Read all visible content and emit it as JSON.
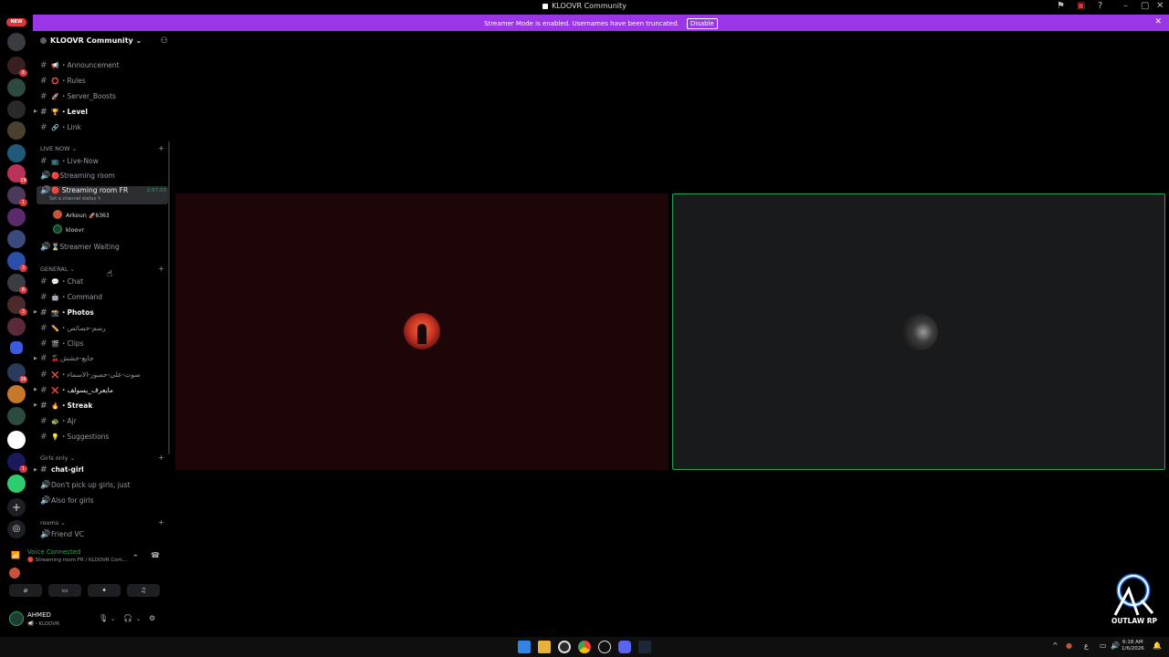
{
  "window": {
    "title": "KLOOVR Community"
  },
  "banner": {
    "message": "Streamer Mode is enabled. Usernames have been truncated.",
    "disable_label": "Disable"
  },
  "rail": {
    "new_badge": "NEW",
    "badges": [
      "6",
      "29",
      "1",
      "3",
      "8",
      "3",
      "1",
      "36"
    ]
  },
  "server": {
    "name": "KLOOVR Community ⌄"
  },
  "channels_top": [
    {
      "emoji": "📢",
      "label": "・Announcement",
      "bold": false
    },
    {
      "emoji": "⭕",
      "label": "・Rules",
      "bold": false
    },
    {
      "emoji": "🚀",
      "label": "・Server_Boosts",
      "bold": false
    },
    {
      "emoji": "🏆",
      "label": "・Level",
      "bold": true
    },
    {
      "emoji": "🔗",
      "label": "・Link",
      "bold": false
    }
  ],
  "live_now": {
    "category": "LIVE NOW ⌄",
    "text_channel": {
      "emoji": "📺",
      "label": "・Live-Now"
    },
    "voice_1": {
      "label": "🔴Streaming room"
    },
    "active": {
      "label": "🔴 Streaming room FR",
      "timer": "2:57:03",
      "status": "Set a channel status ✎"
    },
    "users": [
      {
        "name": "Arkoun",
        "tag": "🚀6363",
        "color": "#c8523a"
      },
      {
        "name": "kloovr",
        "tag": "",
        "color": "#1f3d30"
      }
    ],
    "voice_2": {
      "label": "⌛Streamer Waiting"
    }
  },
  "general": {
    "category": "GENERAL ⌄",
    "channels": [
      {
        "emoji": "💬",
        "label": "・Chat",
        "bold": false,
        "arrow": false
      },
      {
        "emoji": "🤖",
        "label": "・Command",
        "bold": false,
        "arrow": false
      },
      {
        "emoji": "📸",
        "label": "・Photos",
        "bold": true,
        "arrow": true
      },
      {
        "emoji": "✏️",
        "label": "・رسم-خصائص",
        "bold": false,
        "arrow": false
      },
      {
        "emoji": "🎬",
        "label": "・Clips",
        "bold": false,
        "arrow": false
      },
      {
        "emoji": "🍒",
        "label": "جايع-خشش",
        "bold": false,
        "arrow": true
      },
      {
        "emoji": "❌",
        "label": "・صوت-على-حصور-الاسماء",
        "bold": false,
        "arrow": false
      },
      {
        "emoji": "❌",
        "label": "・مايعرف_يسولف",
        "bold": false,
        "arrow": false
      },
      {
        "emoji": "🔥",
        "label": "・Streak",
        "bold": true,
        "arrow": true
      },
      {
        "emoji": "🐢",
        "label": "・Ajr",
        "bold": false,
        "arrow": false
      },
      {
        "emoji": "💡",
        "label": "・Suggestions",
        "bold": false,
        "arrow": false
      }
    ]
  },
  "girls": {
    "category": "Girls only ⌄",
    "channels": [
      {
        "type": "text",
        "label": "chat-girl",
        "bold": true,
        "arrow": true
      },
      {
        "type": "voice",
        "label": "Don't pick up girls, just",
        "bold": false,
        "arrow": false
      },
      {
        "type": "voice",
        "label": "Also for girls",
        "bold": false,
        "arrow": false
      }
    ]
  },
  "rooms": {
    "category": "rooms ⌄",
    "channels": [
      {
        "label": "Friend VC"
      }
    ]
  },
  "voice_panel": {
    "title": "Voice Connected",
    "subtitle": "🔴 Streaming room FR / KLOOVR Com..."
  },
  "user_panel": {
    "name": "AHMED",
    "sub": "📢・KLOOVR"
  },
  "logo": {
    "text": "OUTLAW RP"
  },
  "clock": {
    "time": "6:18 AM",
    "date": "1/6/2026"
  },
  "colors": {
    "banner": "#9b35e8",
    "green": "#23a55a",
    "tile_border": "#23a55a"
  }
}
